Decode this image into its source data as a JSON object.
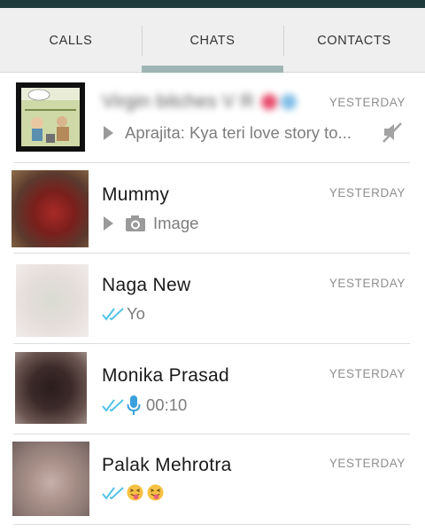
{
  "tabs": [
    {
      "label": "CALLS",
      "active": false
    },
    {
      "label": "CHATS",
      "active": true
    },
    {
      "label": "CONTACTS",
      "active": false
    }
  ],
  "colors": {
    "status_strip": "#1f3a3a",
    "tab_indicator": "#9fb5b3",
    "read_ticks": "#54c3e8",
    "mic": "#3aa0dc"
  },
  "chats": [
    {
      "name": "Virgin bitches V R",
      "time": "YESTERDAY",
      "preview": "Aprajita: Kya teri love story to...",
      "muted": true,
      "icons": [
        "play-icon",
        "mute-icon"
      ]
    },
    {
      "name": "Mummy",
      "time": "YESTERDAY",
      "preview": "Image",
      "icons": [
        "play-icon",
        "camera-icon"
      ]
    },
    {
      "name": "Naga New",
      "time": "YESTERDAY",
      "preview": "Yo",
      "icons": [
        "double-tick-icon"
      ]
    },
    {
      "name": "Monika Prasad",
      "time": "YESTERDAY",
      "preview": "00:10",
      "icons": [
        "double-tick-icon",
        "microphone-icon"
      ]
    },
    {
      "name": "Palak Mehrotra",
      "time": "YESTERDAY",
      "preview": "",
      "icons": [
        "double-tick-icon",
        "tongue-out-emoji-icon",
        "tongue-out-emoji-icon"
      ]
    }
  ]
}
